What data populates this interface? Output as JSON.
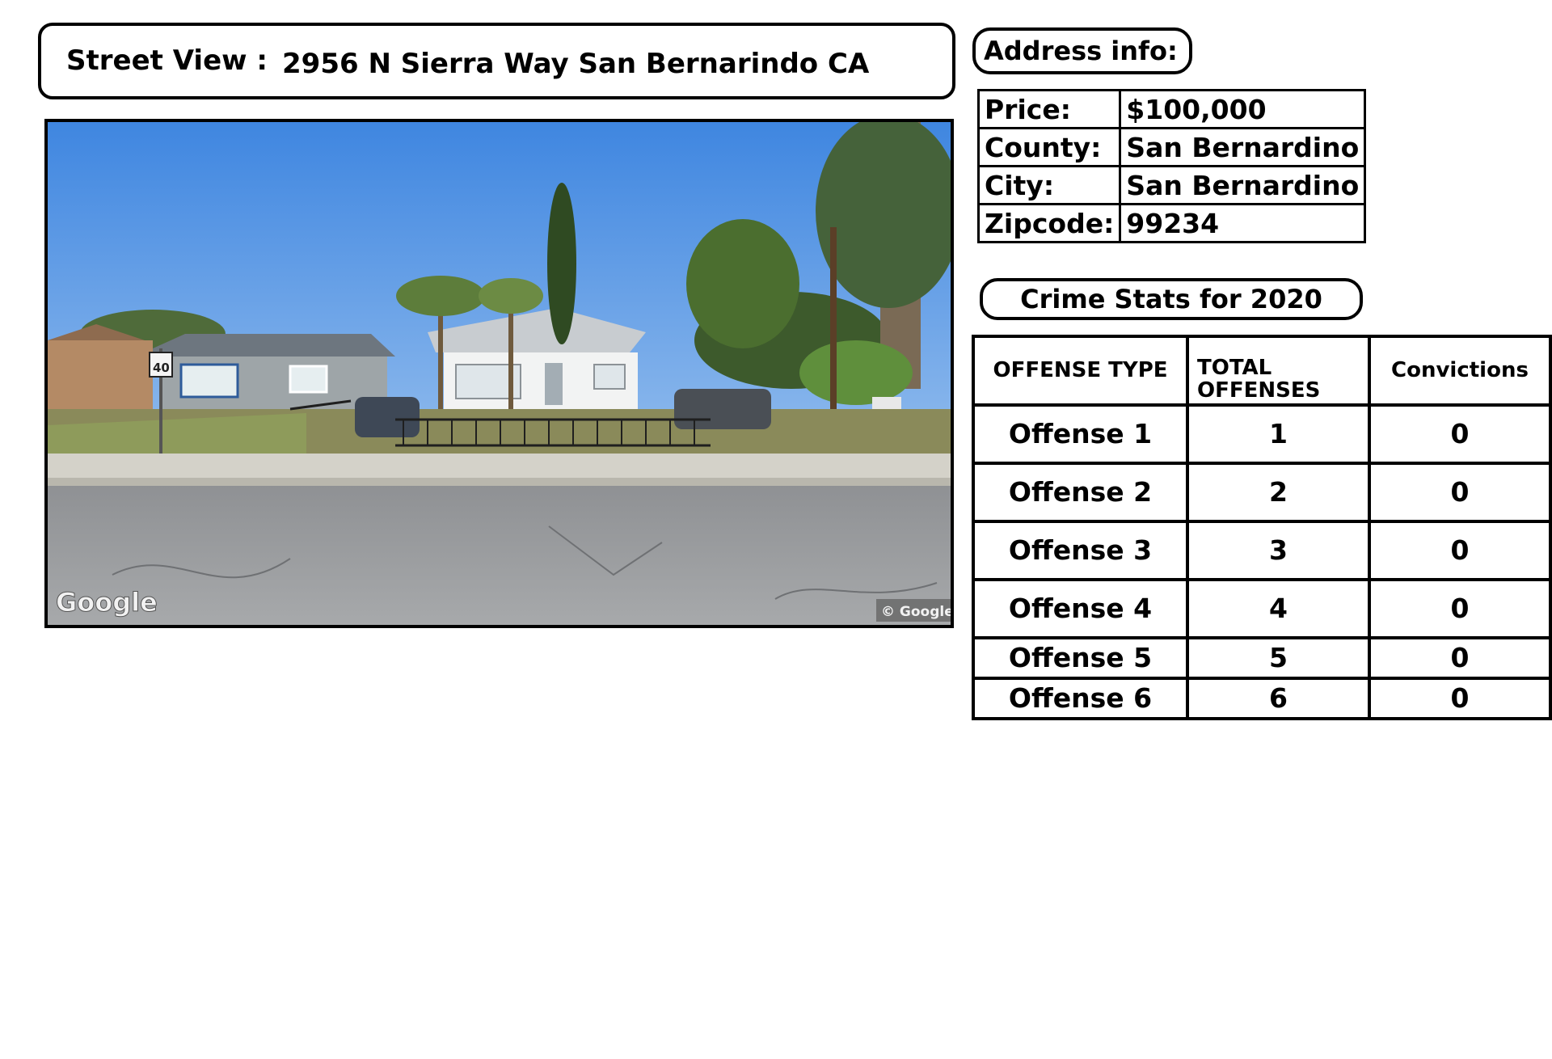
{
  "header": {
    "label": "Street View :",
    "address": "2956 N Sierra Way San Bernarindo CA"
  },
  "photo": {
    "watermark_left": "Google",
    "watermark_right": "© Google",
    "sign_text": "40"
  },
  "address_info": {
    "title": "Address info:",
    "rows": [
      {
        "key": "Price:",
        "value": "$100,000"
      },
      {
        "key": "County:",
        "value": "San Bernardino"
      },
      {
        "key": "City:",
        "value": "San Bernardino"
      },
      {
        "key": "Zipcode:",
        "value": "99234"
      }
    ]
  },
  "crime_stats": {
    "title": "Crime Stats for 2020",
    "columns": [
      "OFFENSE TYPE",
      "TOTAL OFFENSES",
      "Convictions"
    ],
    "rows": [
      {
        "type": "Offense 1",
        "total": "1",
        "convictions": "0"
      },
      {
        "type": "Offense 2",
        "total": "2",
        "convictions": "0"
      },
      {
        "type": "Offense 3",
        "total": "3",
        "convictions": "0"
      },
      {
        "type": "Offense 4",
        "total": "4",
        "convictions": "0"
      },
      {
        "type": "Offense 5",
        "total": "5",
        "convictions": "0"
      },
      {
        "type": "Offense 6",
        "total": "6",
        "convictions": "0"
      }
    ]
  }
}
